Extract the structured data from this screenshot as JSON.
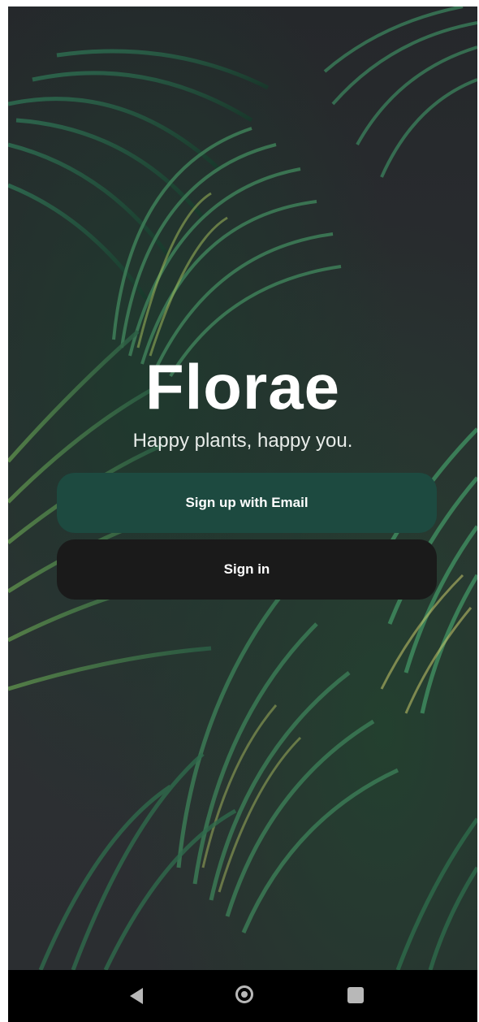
{
  "app": {
    "title": "Florae",
    "tagline": "Happy plants, happy you."
  },
  "actions": {
    "signup_label": "Sign up with Email",
    "signin_label": "Sign in"
  },
  "colors": {
    "signup_button": "#1d4a40",
    "signin_button": "#1a1a1a",
    "navbar": "#000000"
  },
  "navbar": {
    "icons": [
      "back-icon",
      "home-icon",
      "recents-icon"
    ]
  }
}
